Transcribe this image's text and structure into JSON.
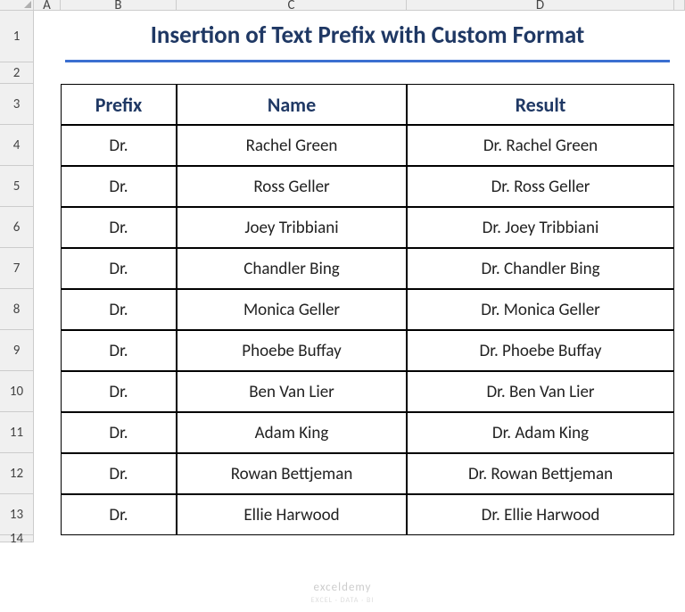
{
  "title": "Insertion of Text Prefix with Custom Format",
  "columns": [
    "A",
    "B",
    "C",
    "D"
  ],
  "row_numbers": [
    "1",
    "2",
    "3",
    "4",
    "5",
    "6",
    "7",
    "8",
    "9",
    "10",
    "11",
    "12",
    "13",
    "14"
  ],
  "headers": {
    "prefix": "Prefix",
    "name": "Name",
    "result": "Result"
  },
  "rows": [
    {
      "prefix": "Dr.",
      "name": "Rachel Green",
      "result": "Dr. Rachel Green"
    },
    {
      "prefix": "Dr.",
      "name": "Ross Geller",
      "result": "Dr. Ross Geller"
    },
    {
      "prefix": "Dr.",
      "name": "Joey Tribbiani",
      "result": "Dr. Joey Tribbiani"
    },
    {
      "prefix": "Dr.",
      "name": "Chandler Bing",
      "result": "Dr. Chandler Bing"
    },
    {
      "prefix": "Dr.",
      "name": "Monica Geller",
      "result": "Dr. Monica Geller"
    },
    {
      "prefix": "Dr.",
      "name": "Phoebe Buffay",
      "result": "Dr. Phoebe Buffay"
    },
    {
      "prefix": "Dr.",
      "name": "Ben Van Lier",
      "result": "Dr. Ben Van Lier"
    },
    {
      "prefix": "Dr.",
      "name": "Adam King",
      "result": "Dr. Adam King"
    },
    {
      "prefix": "Dr.",
      "name": "Rowan Bettjeman",
      "result": "Dr. Rowan Bettjeman"
    },
    {
      "prefix": "Dr.",
      "name": "Ellie Harwood",
      "result": "Dr. Ellie Harwood"
    }
  ],
  "watermark": "exceldemy",
  "watermark_sub": "EXCEL · DATA · BI"
}
